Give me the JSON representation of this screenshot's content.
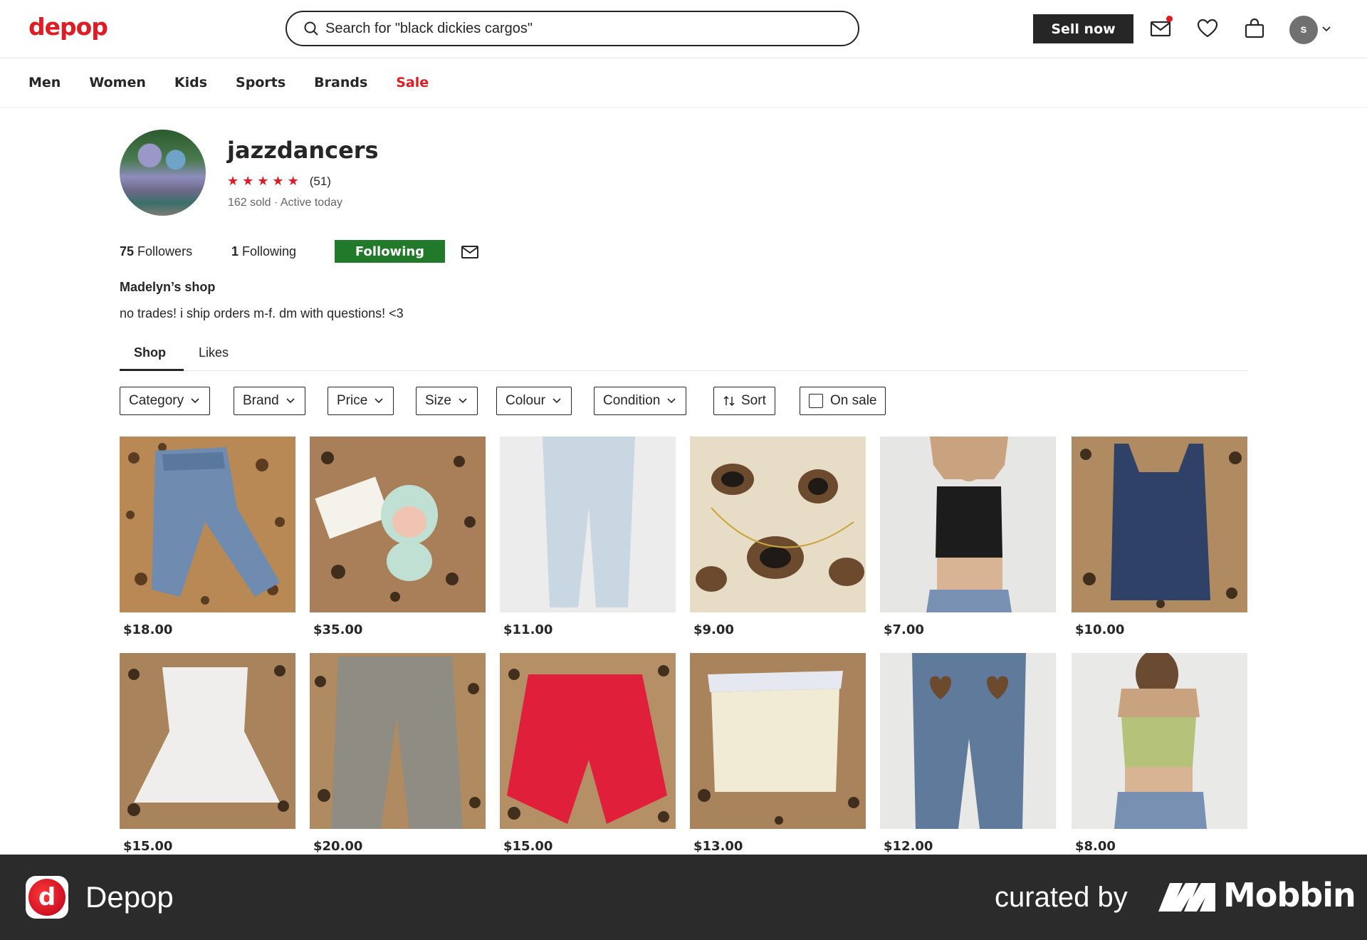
{
  "header": {
    "logo": "depop",
    "search_value": "Search for \"black dickies cargos\"",
    "sell_label": "Sell now",
    "avatar_initial": "s",
    "icons": [
      "search-icon",
      "mail-icon",
      "heart-icon",
      "bag-icon",
      "chevron-down-icon"
    ]
  },
  "nav": {
    "items": [
      "Men",
      "Women",
      "Kids",
      "Sports",
      "Brands",
      "Sale"
    ]
  },
  "profile": {
    "username": "jazzdancers",
    "rating_count": "(51)",
    "stars": 5,
    "sold": "162 sold",
    "active": "Active today",
    "followers_count": "75",
    "followers_label": "Followers",
    "following_count": "1",
    "following_label": "Following",
    "follow_button": "Following",
    "shop_name": "Madelyn’s shop",
    "bio": "no trades! i ship orders m-f. dm with questions! <3"
  },
  "tabs": [
    "Shop",
    "Likes"
  ],
  "filters": [
    "Category",
    "Brand",
    "Price",
    "Size",
    "Colour",
    "Condition",
    "Sort",
    "On sale"
  ],
  "products": [
    {
      "price": "$18.00"
    },
    {
      "price": "$35.00"
    },
    {
      "price": "$11.00"
    },
    {
      "price": "$9.00"
    },
    {
      "price": "$7.00"
    },
    {
      "price": "$10.00"
    },
    {
      "price": "$15.00"
    },
    {
      "price": "$20.00"
    },
    {
      "price": "$15.00"
    },
    {
      "price": "$13.00"
    },
    {
      "price": "$12.00"
    },
    {
      "price": "$8.00"
    }
  ],
  "footer": {
    "app_name": "Depop",
    "badge_letter": "d",
    "curated_by": "curated by",
    "brand": "Mobbin"
  },
  "colors": {
    "brand_red": "#e11b22",
    "following_green": "#217a2a",
    "text": "#262626",
    "footer_bg": "#2b2b2b"
  }
}
